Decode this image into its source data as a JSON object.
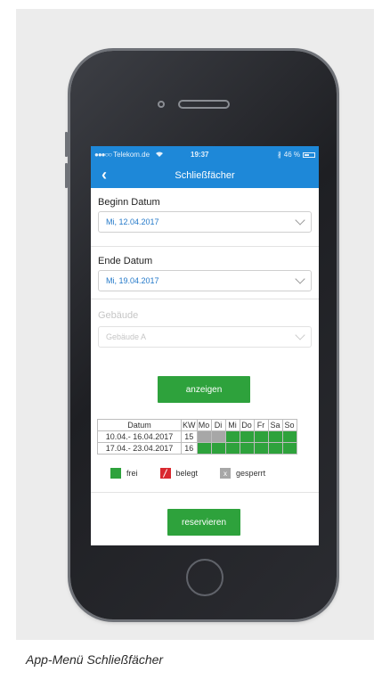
{
  "status_bar": {
    "signal": "●●●○○",
    "carrier": "Telekom.de",
    "wifi_icon": "wifi-icon",
    "time": "19:37",
    "bluetooth": "∦",
    "battery_text": "46 %"
  },
  "navbar": {
    "back_label": "‹",
    "title": "Schließfächer"
  },
  "begin": {
    "label": "Beginn Datum",
    "value": "Mi, 12.04.2017"
  },
  "end": {
    "label": "Ende Datum",
    "value": "Mi, 19.04.2017"
  },
  "building": {
    "label": "Gebäude",
    "value": "Gebäude A"
  },
  "show_button": "anzeigen",
  "calendar": {
    "headers": [
      "Datum",
      "KW",
      "Mo",
      "Di",
      "Mi",
      "Do",
      "Fr",
      "Sa",
      "So"
    ],
    "rows": [
      {
        "date": "10.04.- 16.04.2017",
        "kw": "15",
        "days": [
          "gesperrt",
          "gesperrt",
          "frei",
          "frei",
          "frei",
          "frei",
          "frei"
        ]
      },
      {
        "date": "17.04.- 23.04.2017",
        "kw": "16",
        "days": [
          "frei",
          "frei",
          "frei",
          "frei",
          "frei",
          "frei",
          "frei"
        ]
      }
    ]
  },
  "legend": {
    "frei": "frei",
    "belegt": "belegt",
    "gesperrt": "gesperrt",
    "gesperrt_mark": "x"
  },
  "reserve_button": "reservieren",
  "caption": "App-Menü Schließfächer",
  "colors": {
    "accent_blue": "#1e88d8",
    "button_green": "#2ea23c",
    "status_red": "#d9282f",
    "status_gray": "#a7a7a7"
  }
}
